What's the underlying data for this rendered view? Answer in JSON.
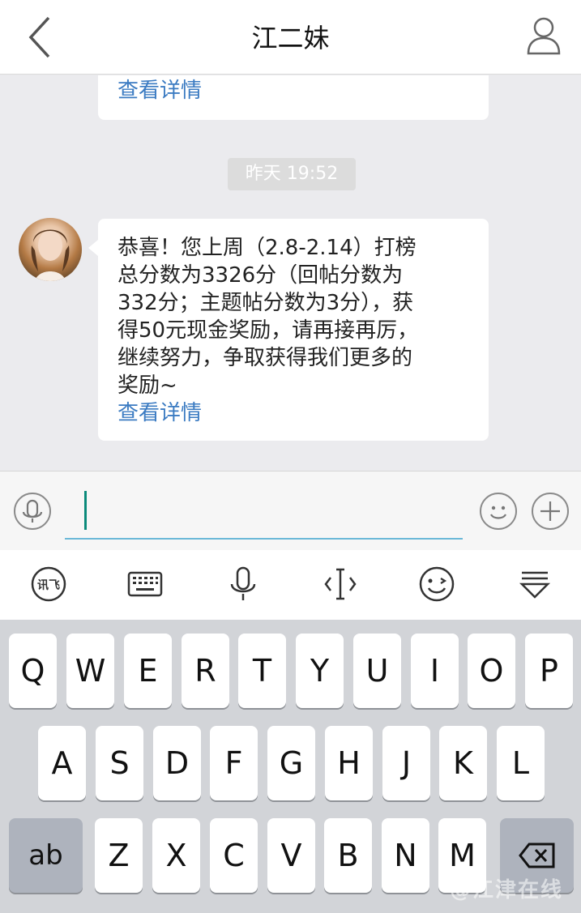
{
  "header": {
    "title": "江二妹"
  },
  "chat": {
    "top_bubble": {
      "link": "查看详情"
    },
    "timestamp": "昨天 19:52",
    "message": {
      "lines": [
        "恭喜！您上周（2.8-2.14）打榜",
        "总分数为3326分（回帖分数为",
        "332分；主题帖分数为3分），获",
        "得50元现金奖励，请再接再厉，",
        "继续努力，争取获得我们更多的",
        "奖励~"
      ],
      "link": "查看详情"
    }
  },
  "input": {
    "value": "",
    "placeholder": ""
  },
  "ime_toolbar": {
    "items": [
      "ifly-logo-icon",
      "keyboard-icon",
      "microphone-icon",
      "cursor-icon",
      "emoji-wink-icon",
      "hide-keyboard-icon"
    ]
  },
  "keyboard": {
    "row1": [
      "Q",
      "W",
      "E",
      "R",
      "T",
      "Y",
      "U",
      "I",
      "O",
      "P"
    ],
    "row2": [
      "A",
      "S",
      "D",
      "F",
      "G",
      "H",
      "J",
      "K",
      "L"
    ],
    "row3": [
      "Z",
      "X",
      "C",
      "V",
      "B",
      "N",
      "M"
    ],
    "mode_key": "ab"
  },
  "watermark": "@江津在线",
  "colors": {
    "link": "#3b7bc2",
    "input_underline": "#6bb8d8",
    "cursor": "#0a8a7a"
  }
}
